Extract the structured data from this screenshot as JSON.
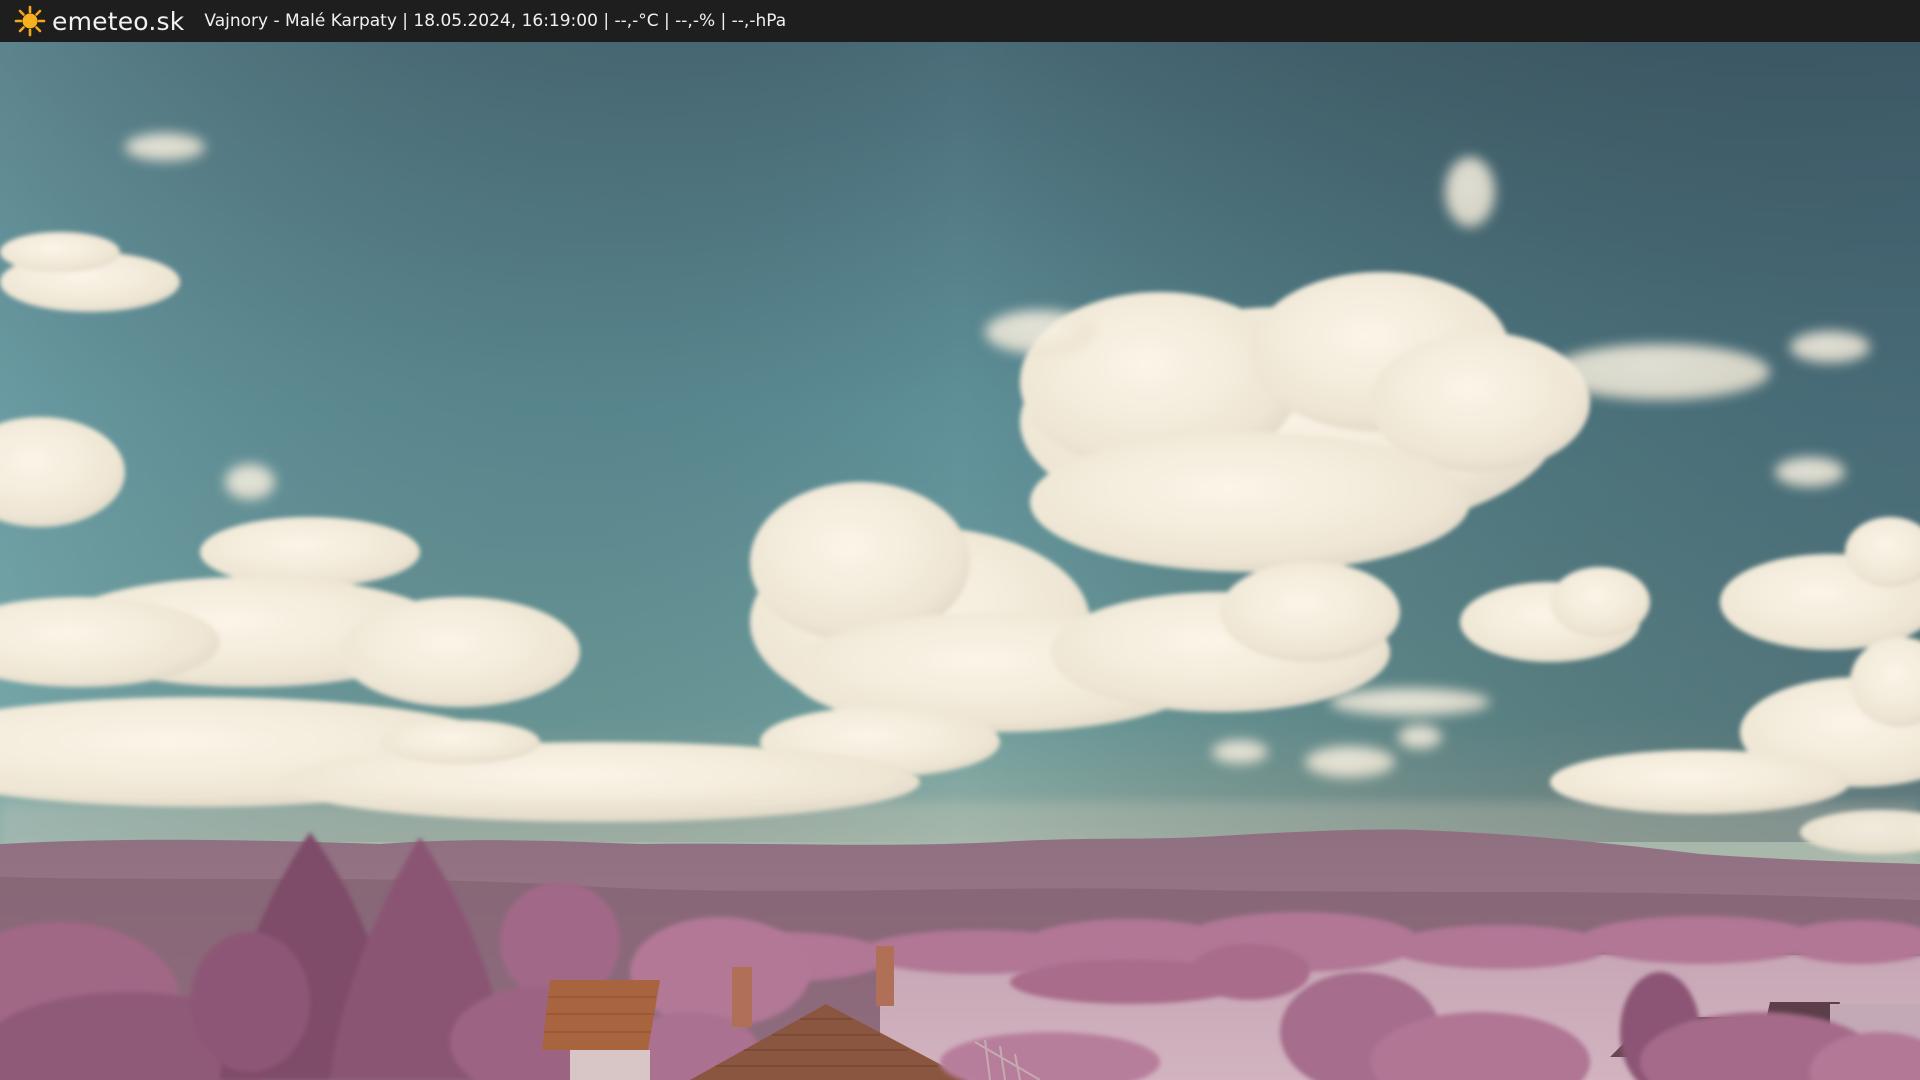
{
  "header": {
    "brand": "emeteo.sk",
    "brand_icon": "sun-icon",
    "caption": "Vajnory - Malé Karpaty | 18.05.2024, 16:19:00 | --,-°C | --,-% | --,-hPa"
  },
  "webcam": {
    "scene": "infrared landscape: sky with cumulus clouds, Malé Karpaty hills, pink-toned trees and roofs",
    "colors": {
      "sky_top": "#3f5d6b",
      "sky_mid": "#5e8f98",
      "sky_horizon": "#a9b7a8",
      "cloud": "#f1eadb",
      "hills": "#8c6878",
      "foliage": "#b67f9a",
      "field": "#c9a9b6",
      "roof": "#8c5a45"
    }
  }
}
